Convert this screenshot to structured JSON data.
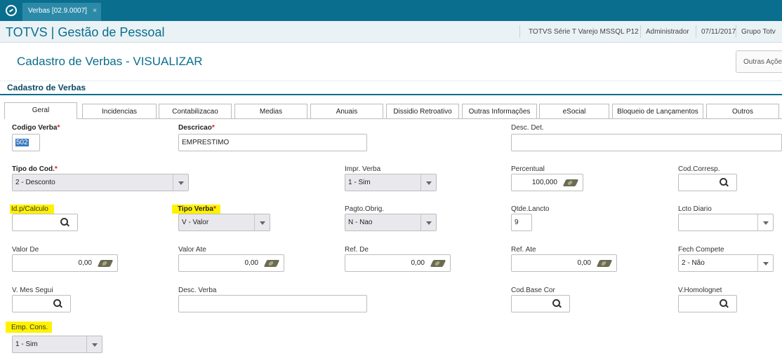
{
  "topbar": {
    "tab_label": "Verbas [02.9.0007]",
    "close": "×"
  },
  "header": {
    "app_title": "TOTVS | Gestão de Pessoal",
    "environment": "TOTVS Série T Varejo MSSQL P12",
    "user": "Administrador",
    "date": "07/11/2017",
    "group": "Grupo Totv"
  },
  "page": {
    "title": "Cadastro de Verbas - VISUALIZAR",
    "other_actions": "Outras Açõe"
  },
  "section": {
    "title": "Cadastro de Verbas"
  },
  "tabs": [
    "Geral",
    "Incidencias",
    "Contabilizacao",
    "Medias",
    "Anuais",
    "Dissidio Retroativo",
    "Outras Informações",
    "eSocial",
    "Bloqueio de Lançamentos",
    "Outros"
  ],
  "fields": {
    "codigo_verba": {
      "label": "Codigo Verba",
      "required": "*",
      "value": "502"
    },
    "descricao": {
      "label": "Descricao",
      "required": "*",
      "value": "EMPRESTIMO"
    },
    "desc_det": {
      "label": "Desc. Det.",
      "value": ""
    },
    "tipo_cod": {
      "label": "Tipo do Cod.",
      "required": "*",
      "value": "2 - Desconto"
    },
    "impr_verba": {
      "label": "Impr. Verba",
      "value": "1 - Sim"
    },
    "percentual": {
      "label": "Percentual",
      "value": "100,000"
    },
    "cod_corresp": {
      "label": "Cod.Corresp.",
      "value": ""
    },
    "id_calculo": {
      "label": "Id.p/Calculo",
      "value": ""
    },
    "tipo_verba": {
      "label": "Tipo Verba",
      "required": "*",
      "value": "V - Valor"
    },
    "pagto_obrig": {
      "label": "Pagto.Obrig.",
      "value": "N - Nao"
    },
    "qtde_lancto": {
      "label": "Qtde.Lancto",
      "value": "9"
    },
    "lcto_diario": {
      "label": "Lcto Diario",
      "value": ""
    },
    "valor_de": {
      "label": "Valor De",
      "value": "0,00"
    },
    "valor_ate": {
      "label": "Valor Ate",
      "value": "0,00"
    },
    "ref_de": {
      "label": "Ref. De",
      "value": "0,00"
    },
    "ref_ate": {
      "label": "Ref. Ate",
      "value": "0,00"
    },
    "fech_compete": {
      "label": "Fech Compete",
      "value": "2 - Não"
    },
    "v_mes_segui": {
      "label": "V. Mes Segui",
      "value": ""
    },
    "desc_verba": {
      "label": "Desc. Verba",
      "value": ""
    },
    "cod_base_cor": {
      "label": "Cod.Base Cor",
      "value": ""
    },
    "v_homolognet": {
      "label": "V.Homolognet",
      "value": ""
    },
    "emp_cons": {
      "label": "Emp. Cons.",
      "value": "1 - Sim"
    }
  }
}
